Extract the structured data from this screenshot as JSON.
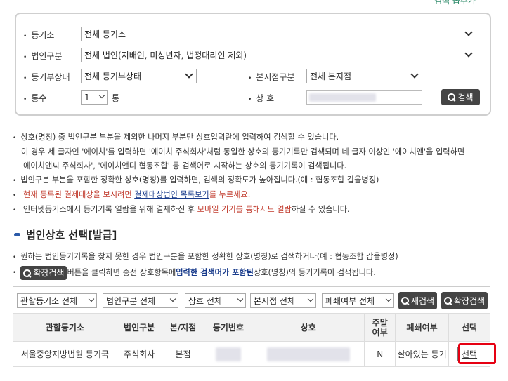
{
  "top_link": "검색 옵추가",
  "search": {
    "registry_label": "등기소",
    "registry_value": "전체 등기소",
    "corp_type_label": "법인구분",
    "corp_type_value": "전체 법인(지배인, 미성년자, 법정대리인 제외)",
    "status_label": "등기부상태",
    "status_value": "전체 등기부상태",
    "branch_label": "본지점구분",
    "branch_value": "전체 본지점",
    "count_label": "통수",
    "count_value": "1",
    "count_unit": "통",
    "name_label": "상 호",
    "search_button": "검색"
  },
  "notes": [
    "상호(명칭) 중 법인구분 부분을 제외한 나머지 부분만 상호입력란에 입력하여 검색할 수 있습니다.",
    "이 경우 세 글자인 '에이치'를 입력하면 '에이치 주식회사'처럼 동일한 상호의 등기기록만 검색되며 네 글자 이상인 '에이치앤'을 입력하면",
    "'에이치앤씨 주식회사', '에이치앤디 협동조합' 등 검색어로 시작하는 상호의 등기기록이 검색됩니다.",
    "법인구분 부분을 포함한 정확한 상호(명칭)를 입력하면, 검색의 정확도가 높아집니다.(예 : 협동조합 갑을병정)",
    "현재 등록된 결제대상을 보시려면",
    "결제대상법인 목록보기",
    "를 누르세요.",
    "인터넷등기소에서 등기기록 열람을 위해 결제하신 후",
    "모바일 기기를 통해서도 열람",
    "하실 수 있습니다."
  ],
  "section_title": "법인상호 선택[발급]",
  "notes2": {
    "line1": "원하는 법인등기기록을 찾지 못한 경우 법인구분을 포함한 정확한 상호(명칭)로 검색하거나(예 : 협동조합 갑을병정)",
    "ext_button": "확장검색",
    "line2a": " 버튼을 클릭하면 종전 상호항목에 ",
    "line2b": "입력한 검색어가 포함된",
    "line2c": " 상호(명칭)의 등기기록이 검색됩니다."
  },
  "filters": {
    "office": "관할등기소 전체",
    "corp": "법인구분 전체",
    "name": "상호 전체",
    "branch": "본지점 전체",
    "closed": "폐쇄여부 전체",
    "research_button": "재검색",
    "ext_button": "확장검색"
  },
  "table": {
    "headers": [
      "관할등기소",
      "법인구분",
      "본/지점",
      "등기번호",
      "상호",
      "주말여부",
      "폐쇄여부",
      "선택"
    ],
    "header_weekend_1": "주말",
    "header_weekend_2": "여부",
    "row": {
      "office": "서울중앙지방법원 등기국",
      "corp": "주식회사",
      "branch": "본점",
      "weekend": "N",
      "closed": "살아있는 등기",
      "select": "선택"
    }
  }
}
